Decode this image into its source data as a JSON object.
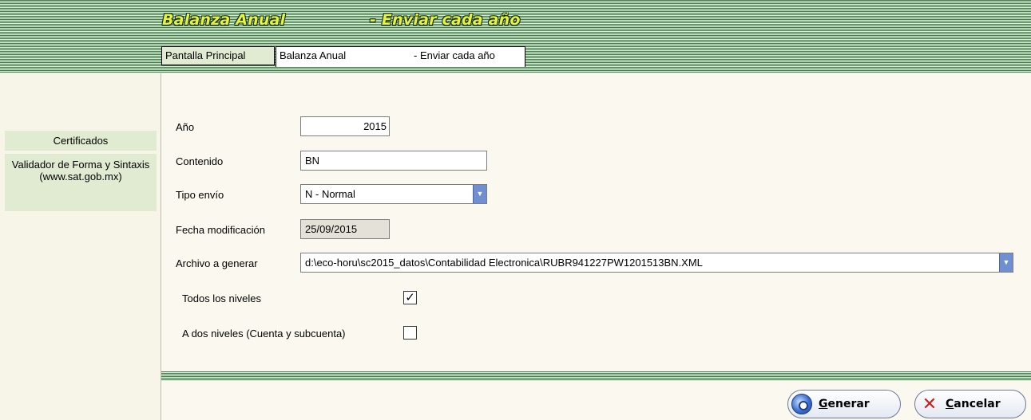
{
  "window": {
    "title_left": "Balanza Anual",
    "title_right": "- Enviar cada año"
  },
  "tabs": [
    {
      "label": "Pantalla Principal"
    },
    {
      "label": "Balanza Anual",
      "sublabel": "- Enviar cada año"
    }
  ],
  "sidebar": {
    "items": [
      {
        "label": "Certificados"
      },
      {
        "label": "Validador de Forma y Sintaxis (www.sat.gob.mx)"
      }
    ]
  },
  "form": {
    "anio": {
      "label": "Año",
      "value": "2015"
    },
    "contenido": {
      "label": "Contenido",
      "value": "BN"
    },
    "tipo_envio": {
      "label": "Tipo envío",
      "value": "N - Normal"
    },
    "fecha_modificacion": {
      "label": "Fecha modificación",
      "value": "25/09/2015"
    },
    "archivo": {
      "label": "Archivo a generar",
      "value": "d:\\eco-horu\\sc2015_datos\\Contabilidad Electronica\\RUBR941227PW1201513BN.XML"
    },
    "todos_niveles": {
      "label": "Todos los niveles",
      "checked": true
    },
    "dos_niveles": {
      "label": "A dos niveles (Cuenta y subcuenta)",
      "checked": false
    }
  },
  "buttons": {
    "generar": {
      "label_first": "G",
      "label_rest": "enerar",
      "icon": "gear-icon"
    },
    "cancelar": {
      "label_first": "C",
      "label_rest": "ancelar",
      "icon": "close-icon"
    }
  },
  "colors": {
    "banner_green": "#3c7f51",
    "title_yellow": "#e8f040",
    "tab_bg": "#e1ebd2",
    "dropdown_blue": "#6f8fd2"
  }
}
